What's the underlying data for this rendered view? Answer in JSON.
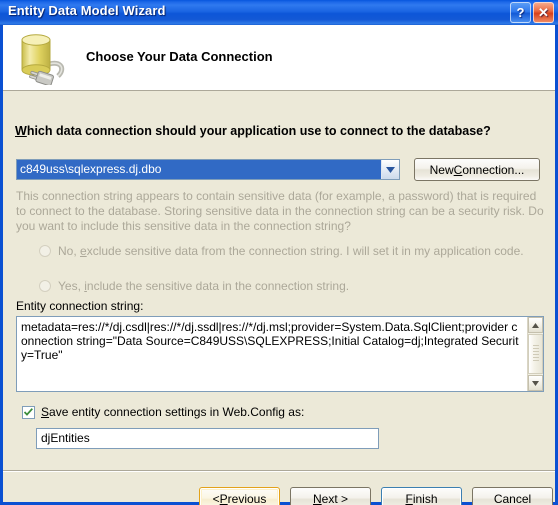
{
  "window": {
    "title": "Entity Data Model Wizard",
    "help_button_label": "?",
    "close_button_label": "✕",
    "titlebar_color": "#0a50d2",
    "body_color": "#ece9d8"
  },
  "banner": {
    "heading": "Choose Your Data Connection",
    "icon": "database-plug-icon"
  },
  "question": {
    "accesskey": "W",
    "rest": "hich data connection should your application use to connect to the database?"
  },
  "connection": {
    "combo_value": "c849uss\\sqlexpress.dj.dbo",
    "combo_highlight_color": "#316ac5",
    "new_connection_prefix": "New ",
    "new_connection_accesskey": "C",
    "new_connection_suffix": "onnection..."
  },
  "sensitive": {
    "paragraph": "This connection string appears to contain sensitive data (for example, a password) that is required to connect to the database. Storing sensitive data in the connection string can be a security risk. Do you want to include this sensitive data in the connection string?",
    "disabled_text_color": "#aca899",
    "options": [
      {
        "prefix": "No, ",
        "accesskey": "e",
        "suffix": "xclude sensitive data from the connection string. I will set it in my application code.",
        "selected": false,
        "enabled": false
      },
      {
        "prefix": "Yes, ",
        "accesskey": "i",
        "suffix": "nclude the sensitive data in the connection string.",
        "selected": false,
        "enabled": false
      }
    ]
  },
  "entity_connection": {
    "label": "Entity connection string:",
    "value": "metadata=res://*/dj.csdl|res://*/dj.ssdl|res://*/dj.msl;provider=System.Data.SqlClient;provider connection string=\"Data Source=C849USS\\SQLEXPRESS;Initial Catalog=dj;Integrated Security=True\"",
    "scroll_up_label": "▲",
    "scroll_down_label": "▼"
  },
  "save_settings": {
    "checked": true,
    "prefix": "",
    "accesskey": "S",
    "suffix": "ave entity connection settings in Web.Config as:",
    "input_value": "djEntities"
  },
  "footer": {
    "buttons": [
      {
        "prefix": "< ",
        "accesskey": "P",
        "suffix": "revious",
        "state": "hot"
      },
      {
        "prefix": "",
        "accesskey": "N",
        "suffix": "ext >",
        "state": "normal"
      },
      {
        "prefix": "",
        "accesskey": "F",
        "suffix": "inish",
        "state": "default"
      },
      {
        "prefix": "Cancel",
        "accesskey": "",
        "suffix": "",
        "state": "normal"
      }
    ]
  }
}
